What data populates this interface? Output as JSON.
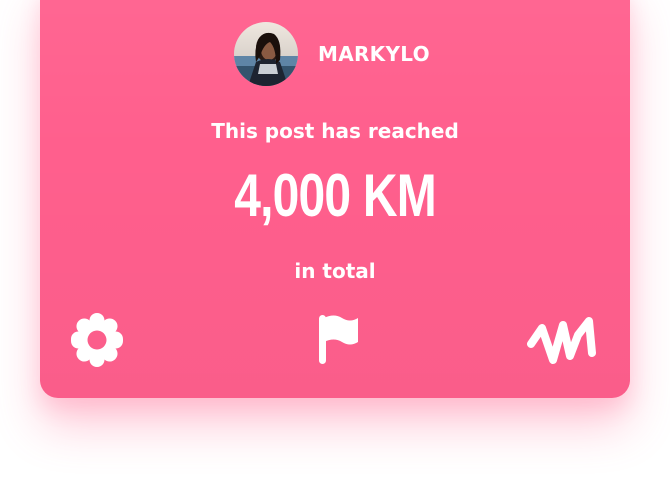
{
  "post": {
    "username": "MARKYLO",
    "reached_text": "This post has reached",
    "distance": "4,000 KM",
    "total_text": "in total"
  },
  "actions": {
    "settings_icon": "gear-icon",
    "flag_icon": "flag-icon",
    "activity_icon": "activity-icon"
  },
  "colors": {
    "card_background": "#ff5f8d",
    "text": "#ffffff",
    "page_background": "#ffffff"
  }
}
